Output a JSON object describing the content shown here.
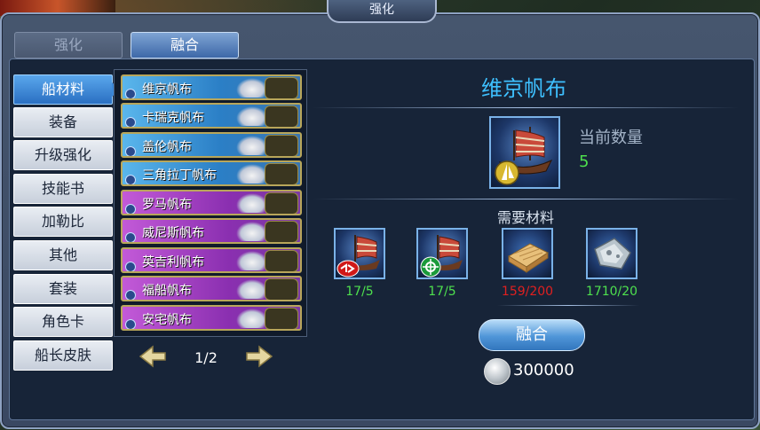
{
  "window": {
    "title": "强化"
  },
  "top_tabs": [
    {
      "label": "强化",
      "active": false
    },
    {
      "label": "融合",
      "active": true
    }
  ],
  "categories": [
    {
      "label": "船材料",
      "active": true
    },
    {
      "label": "装备",
      "active": false
    },
    {
      "label": "升级强化",
      "active": false
    },
    {
      "label": "技能书",
      "active": false
    },
    {
      "label": "加勒比",
      "active": false
    },
    {
      "label": "其他",
      "active": false
    },
    {
      "label": "套装",
      "active": false
    },
    {
      "label": "角色卡",
      "active": false
    },
    {
      "label": "船长皮肤",
      "active": false
    }
  ],
  "items": [
    {
      "label": "维京帆布",
      "color": "blue"
    },
    {
      "label": "卡瑞克帆布",
      "color": "blue"
    },
    {
      "label": "盖伦帆布",
      "color": "blue"
    },
    {
      "label": "三角拉丁帆布",
      "color": "blue"
    },
    {
      "label": "罗马帆布",
      "color": "purple"
    },
    {
      "label": "威尼斯帆布",
      "color": "purple"
    },
    {
      "label": "英吉利帆布",
      "color": "purple"
    },
    {
      "label": "福船帆布",
      "color": "purple"
    },
    {
      "label": "安宅帆布",
      "color": "purple"
    }
  ],
  "pager": {
    "text": "1/2"
  },
  "detail": {
    "title": "维京帆布",
    "qty_label": "当前数量",
    "qty_value": "5",
    "need_label": "需要材料",
    "materials": [
      {
        "icon": "red-ship-icon",
        "count": "17/5",
        "ok": true
      },
      {
        "icon": "green-ship-icon",
        "count": "17/5",
        "ok": true
      },
      {
        "icon": "wood-plank-icon",
        "count": "159/200",
        "ok": false
      },
      {
        "icon": "iron-ore-icon",
        "count": "1710/20",
        "ok": true
      }
    ],
    "fuse_label": "融合",
    "cost": "300000"
  },
  "colors": {
    "title_blue": "#3ec0ff",
    "ok_green": "#4ee04e",
    "lack_red": "#e02020",
    "item_blue": "#2b7fc6",
    "item_purple": "#8a2fb0"
  }
}
